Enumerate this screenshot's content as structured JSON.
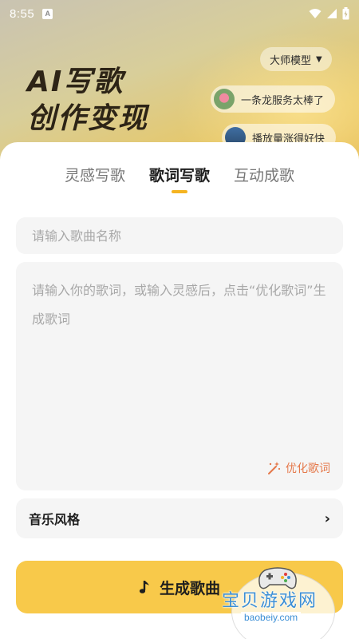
{
  "status_bar": {
    "time": "8:55",
    "notif_label": "A"
  },
  "hero": {
    "title_line1": "AI写歌",
    "title_line2": "创作变现",
    "model_select": {
      "label": "大师模型"
    },
    "bubbles": [
      {
        "text": "一条龙服务太棒了"
      },
      {
        "text": "播放量涨得好快"
      }
    ]
  },
  "tabs": [
    {
      "label": "灵感写歌",
      "active": false
    },
    {
      "label": "歌词写歌",
      "active": true
    },
    {
      "label": "互动成歌",
      "active": false
    }
  ],
  "form": {
    "song_name_placeholder": "请输入歌曲名称",
    "lyrics_placeholder": "请输入你的歌词，或输入灵感后，点击“优化歌词”生成歌词",
    "optimize_label": "优化歌词",
    "music_style_label": "音乐风格"
  },
  "generate_button": {
    "label": "生成歌曲"
  },
  "watermark": {
    "text": "宝贝游戏网",
    "url": "baobeiy.com"
  },
  "colors": {
    "accent": "#f8c94a",
    "tab_indicator": "#f5b421",
    "optimize": "#e5794b"
  },
  "icons": {
    "model_select": "triangle-down-icon",
    "optimize": "magic-wand-icon",
    "style_row": "chevron-right-icon",
    "generate": "music-note-icon"
  }
}
